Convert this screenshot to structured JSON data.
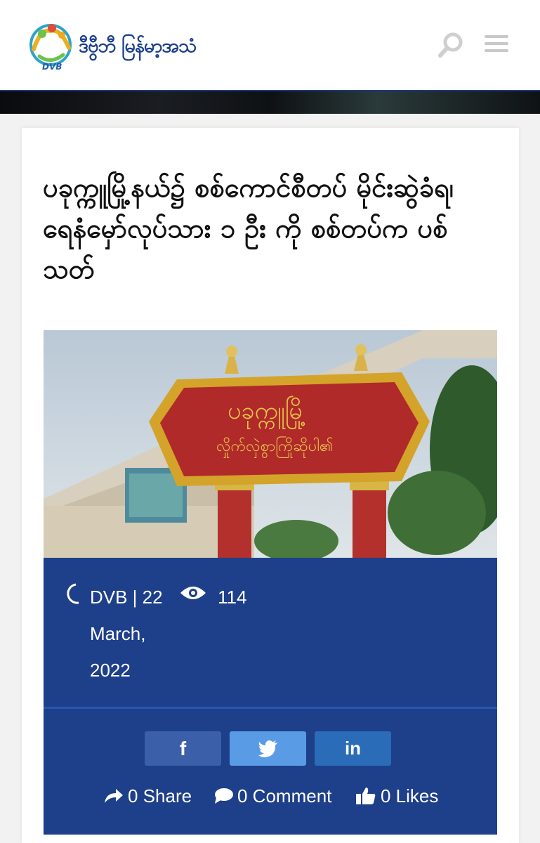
{
  "header": {
    "logo_text": "ဒီဗွီဘီ မြန်မာ့အသံ",
    "logo_sub": "DVB"
  },
  "article": {
    "title": "ပခုက္ကူမြို့နယ်၌ စစ်ကောင်စီတပ် မိုင်းဆွဲခံရ၊ ရေနံမှော်လုပ်သား ၁ ဦး ကို စစ်တပ်က ပစ်သတ်",
    "hero": {
      "sign_line1": "ပခုက္ကူမြို့",
      "sign_line2": "လှိုက်လှဲစွာကြိုဆိုပါ၏"
    },
    "meta": {
      "author_date": "DVB | 22 March, 2022",
      "views": "114"
    }
  },
  "share": {
    "facebook_icon": "f",
    "linkedin_icon": "in",
    "share_label": "0 Share",
    "comment_label": "0 Comment",
    "likes_label": "0 Likes"
  },
  "colors": {
    "brand_blue": "#1b3f8c",
    "meta_bg": "#1e3f8a",
    "facebook": "#3b5fa8",
    "twitter": "#5a9be6",
    "linkedin": "#2a6cb7"
  }
}
